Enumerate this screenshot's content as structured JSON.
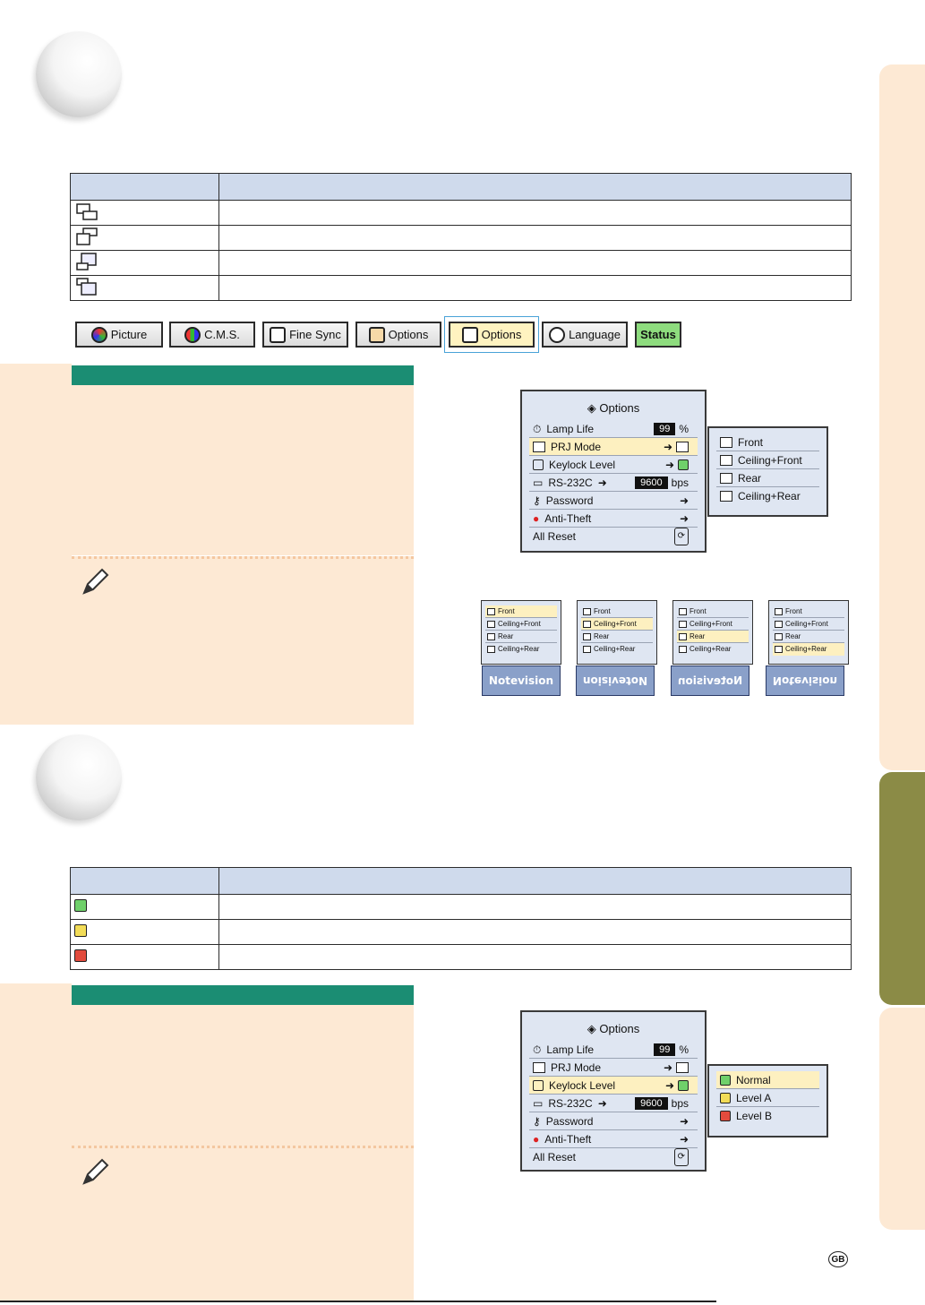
{
  "menu_tabs": [
    {
      "label": "Picture"
    },
    {
      "label": "C.M.S."
    },
    {
      "label": "Fine Sync"
    },
    {
      "label": "Options"
    },
    {
      "label": "Options"
    },
    {
      "label": "Language"
    },
    {
      "label": "Status"
    }
  ],
  "osd1": {
    "title": "Options",
    "rows": [
      {
        "label": "Lamp Life",
        "value": "99",
        "unit": "%"
      },
      {
        "label": "PRJ Mode"
      },
      {
        "label": "Keylock Level"
      },
      {
        "label": "RS-232C",
        "value": "9600",
        "unit": "bps"
      },
      {
        "label": "Password"
      },
      {
        "label": "Anti-Theft"
      },
      {
        "label": "All Reset"
      }
    ],
    "submenu": [
      "Front",
      "Ceiling+Front",
      "Rear",
      "Ceiling+Rear"
    ]
  },
  "previews": {
    "items": [
      "Front",
      "Ceiling+Front",
      "Rear",
      "Ceiling+Rear"
    ],
    "logo": "Notevision"
  },
  "osd2": {
    "title": "Options",
    "rows": [
      {
        "label": "Lamp Life",
        "value": "99",
        "unit": "%"
      },
      {
        "label": "PRJ Mode"
      },
      {
        "label": "Keylock Level"
      },
      {
        "label": "RS-232C",
        "value": "9600",
        "unit": "bps"
      },
      {
        "label": "Password"
      },
      {
        "label": "Anti-Theft"
      },
      {
        "label": "All Reset"
      }
    ],
    "submenu": [
      "Normal",
      "Level A",
      "Level B"
    ]
  },
  "footer": {
    "region_badge": "GB"
  }
}
